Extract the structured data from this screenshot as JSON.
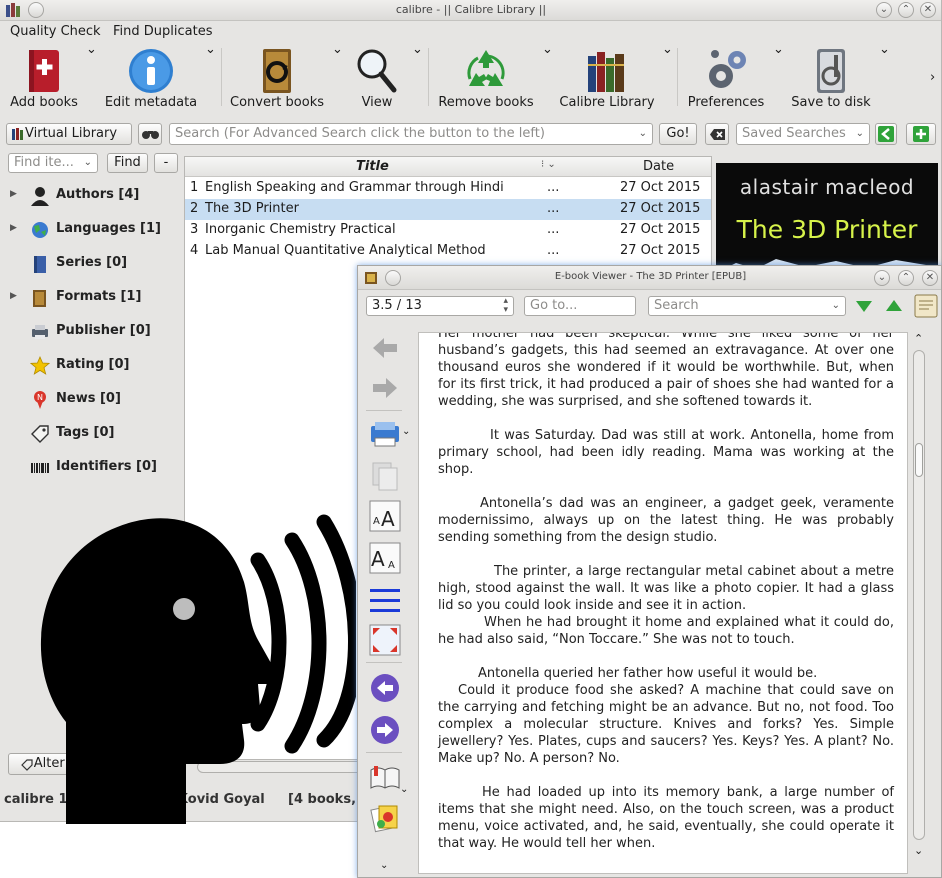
{
  "main_window": {
    "title": "calibre - || Calibre Library ||",
    "menu": [
      "Quality Check",
      "Find Duplicates"
    ],
    "toolbar": [
      {
        "label": "Add books",
        "icon": "add-book-icon"
      },
      {
        "label": "Edit metadata",
        "icon": "info-icon"
      },
      {
        "label": "Convert books",
        "icon": "convert-icon"
      },
      {
        "label": "View",
        "icon": "magnifier-icon"
      },
      {
        "label": "Remove books",
        "icon": "recycle-icon"
      },
      {
        "label": "Calibre Library",
        "icon": "library-books-icon"
      },
      {
        "label": "Preferences",
        "icon": "gears-icon"
      },
      {
        "label": "Save to disk",
        "icon": "disk-icon"
      }
    ],
    "virtual_library": "Virtual Library",
    "search_placeholder": "Search (For Advanced Search click the button to the left)",
    "go_label": "Go!",
    "saved_searches_placeholder": "Saved Searches",
    "find_item_placeholder": "Find ite...",
    "find_label": "Find",
    "collapse_label": "-",
    "tags": [
      {
        "label": "Authors [4]",
        "expandable": true,
        "icon": "person-icon"
      },
      {
        "label": "Languages [1]",
        "expandable": true,
        "icon": "globe-icon"
      },
      {
        "label": "Series [0]",
        "expandable": false,
        "icon": "series-book-icon"
      },
      {
        "label": "Formats [1]",
        "expandable": true,
        "icon": "book-format-icon"
      },
      {
        "label": "Publisher [0]",
        "expandable": false,
        "icon": "printer-icon"
      },
      {
        "label": "Rating [0]",
        "expandable": false,
        "icon": "star-icon"
      },
      {
        "label": "News [0]",
        "expandable": false,
        "icon": "news-pin-icon"
      },
      {
        "label": "Tags [0]",
        "expandable": false,
        "icon": "tag-icon"
      },
      {
        "label": "Identifiers [0]",
        "expandable": false,
        "icon": "barcode-icon"
      }
    ],
    "alter_tag_browser": "Alter Tag Browser",
    "columns": {
      "title": "Title",
      "date": "Date"
    },
    "books": [
      {
        "num": "1",
        "title": "English Speaking and Grammar through Hindi",
        "more": "...",
        "date": "27 Oct 2015",
        "selected": false
      },
      {
        "num": "2",
        "title": "The 3D Printer",
        "more": "...",
        "date": "27 Oct 2015",
        "selected": true
      },
      {
        "num": "3",
        "title": "Inorganic Chemistry Practical",
        "more": "...",
        "date": "27 Oct 2015",
        "selected": false
      },
      {
        "num": "4",
        "title": "Lab Manual Quantitative Analytical Method",
        "more": "...",
        "date": "27 Oct 2015",
        "selected": false
      }
    ],
    "cover": {
      "author": "alastair macleod",
      "title": "The 3D Printer"
    },
    "status_left": "calibre 1.20 created by Kovid Goyal",
    "status_right": "[4 books,"
  },
  "viewer": {
    "title": "E-book Viewer - The 3D Printer [EPUB]",
    "position": "3.5 / 13",
    "goto_placeholder": "Go to...",
    "search_placeholder": "Search",
    "sidebar_icons": [
      "back-arrow-icon",
      "forward-arrow-icon",
      "print-icon",
      "copy-icon",
      "font-larger-icon",
      "font-smaller-icon",
      "toc-lines-icon",
      "fullscreen-icon",
      "previous-page-icon",
      "next-page-icon",
      "bookmark-book-icon",
      "reference-icon"
    ],
    "paragraphs": [
      "Her mother had been skeptical. While she liked some of her husband’s gadgets, this had seemed an extravagance. At over one thousand euros she wondered if it would be worthwhile. But, when for its first trick, it had produced a pair of shoes she had wanted for a wedding, she was surprised, and she softened towards it.",
      "It was Saturday. Dad was still at work. Antonella, home from primary school, had been idly reading. Mama was working at the shop.",
      "Antonella’s dad was an engineer, a gadget geek, veramente modernissimo, always up on the latest thing. He was probably sending something from the design studio.",
      "The printer, a large rectangular metal cabinet about a metre high, stood against the wall. It was like a photo copier. It had a glass lid so you could look inside and see it in action.",
      "When he had brought it home and explained what it could do, he had also said, “Non Toccare.” She was not to touch.",
      "Antonella queried her father how useful it would be.",
      "Could it produce food she asked? A machine that could save on the carrying and fetching might be an advance. But no, not food. Too complex a molecular structure. Knives and forks? Yes. Simple jewellery? Yes. Plates, cups and saucers? Yes. Keys? Yes. A plant? No. Make up? No.  A person? No.",
      "He had loaded up into its memory bank, a large number of items that she might need. Also, on the touch screen, was a product menu, voice activated, and, he said, eventually, she could operate it that way. He would tell her when."
    ]
  }
}
